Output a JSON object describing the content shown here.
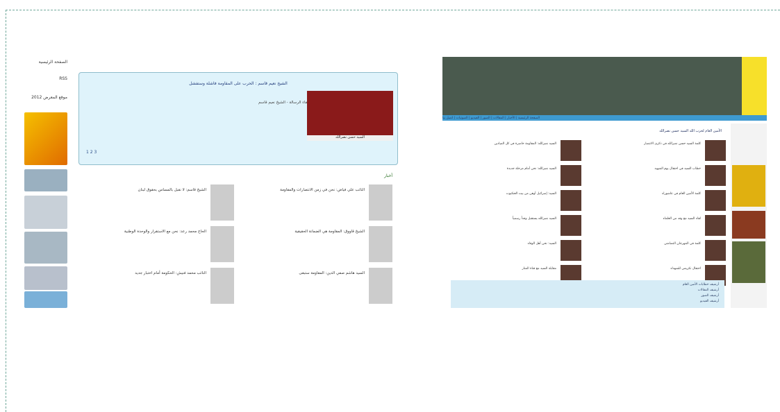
{
  "left_shot": {
    "sidebar_links": [
      "الصفحة الرئيسية",
      "RSS",
      "موقع المعرض 2012"
    ],
    "banner_text": "الشيخ نعيم قاسم : الحرب على المقاومة فاشلة وستفشل",
    "portrait_caption": "السيد حسن نصرالله",
    "sub_text": "لقاء الرسالة - الشيخ نعيم قاسم",
    "pager": "1 2 3",
    "news_title": "أخبار",
    "news": [
      "النائب علي فياض: نحن في زمن الانتصارات والمقاومة",
      "الشيخ قاسم: لا نقبل بالمساس بحقوق لبنان",
      "الشيخ قاووق: المقاومة هي الضمانة الحقيقية",
      "الحاج محمد رعد: نحن مع الاستقرار والوحدة الوطنية",
      "السيد هاشم صفي الدين: المقاومة ستبقى",
      "النائب محمد فنيش: الحكومة أمام اختبار جديد"
    ]
  },
  "right_shot": {
    "nav": "الصفحة الرئيسية | الأخبار | المقالات | الصور | الفيديو | الصوتيات | اتصل بنا",
    "content_title": "الأمين العام لحزب الله السيد حسن نصرالله",
    "news": [
      "كلمة السيد حسن نصرالله في ذكرى الانتصار",
      "السيد نصرالله: المقاومة حاضرة في كل الميادين",
      "خطاب السيد في احتفال يوم الشهيد",
      "السيد نصرالله: نحن أمام مرحلة جديدة",
      "كلمة الأمين العام في عاشوراء",
      "السيد: إسرائيل أوهن من بيت العنكبوت",
      "لقاء السيد مع وفد من العلماء",
      "السيد نصرالله يستقبل وفداً رسمياً",
      "كلمة في المهرجان التضامني",
      "السيد: نحن أهل الوفاء",
      "احتفال تكريمي للشهداء",
      "مقابلة السيد مع قناة المنار"
    ],
    "links": [
      "أرشيف خطابات الأمين العام",
      "أرشيف المقالات",
      "أرشيف الصور",
      "أرشيف الفيديو"
    ]
  }
}
